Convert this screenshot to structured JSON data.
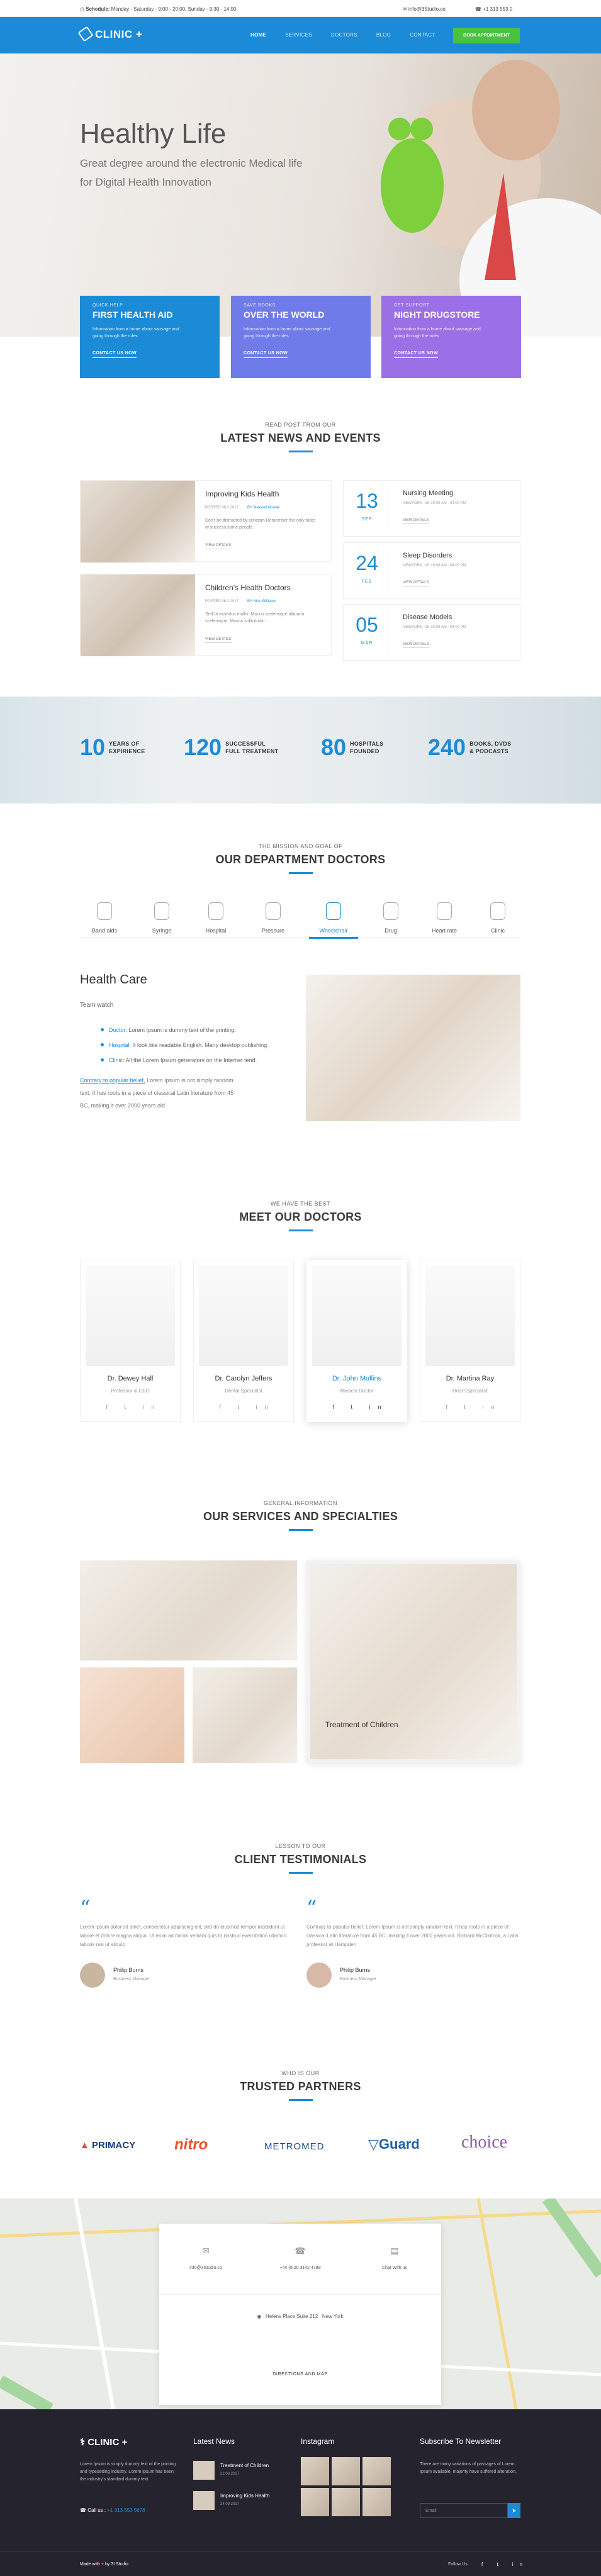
{
  "topbar": {
    "schedule_label": "Schedule:",
    "schedule": "Monday - Saturday - 9:00 - 20:00, Sunday - 9:30 - 14:00",
    "email": "info@3Studio.co",
    "phone": "+1 313 553 0"
  },
  "nav": {
    "logo": "CLINIC +",
    "items": [
      "HOME",
      "SERVICES",
      "DOCTORS",
      "BLOG",
      "CONTACT"
    ],
    "cta": "BOOK APPOINTMENT"
  },
  "hero": {
    "title": "Healthy Life",
    "subtitle": "Great degree around the electronic Medical life for Digital Health Innovation"
  },
  "cards": [
    {
      "small": "QUICK HELP",
      "title": "FIRST HEALTH AID",
      "text": "Information from a home about sausage and going through the rules",
      "link": "CONTACT US NOW",
      "color": "#1b8bd8"
    },
    {
      "small": "SAVE BOOKS",
      "title": "OVER THE WORLD",
      "text": "Information from a home about sausage and going through the rules",
      "link": "CONTACT US NOW",
      "color": "#6f7be8"
    },
    {
      "small": "GET SUPPORT",
      "title": "NIGHT DRUGSTORE",
      "text": "Information from a home about sausage and going through the rules",
      "link": "CONTACT US NOW",
      "color": "#9b6fe6"
    }
  ],
  "news_section": {
    "sub": "READ POST FROM OUR",
    "title": "LATEST NEWS AND EVENTS"
  },
  "news": [
    {
      "title": "Improving Kids Health",
      "date": "POSTED 06.2.2017",
      "author": "BY Maxwell Nowak",
      "excerpt": "Don't be distracted by criticism.Remember the only taste of success some people.",
      "link": "VIEW DETAILS"
    },
    {
      "title": "Children's Health Doctors",
      "date": "POSTED 06.2.2017",
      "author": "BY Nick Williams",
      "excerpt": "Sed ut modulus mollis. Mauris scelerisque aliquam scelerisque. Mauris sollicitudin.",
      "link": "VIEW DETAILS"
    }
  ],
  "events": [
    {
      "day": "13",
      "month": "SEP",
      "title": "Nursing Meeting",
      "meta": "NEWYORK, US  10:00 AM - 04:00 PM",
      "link": "VIEW DETAILS"
    },
    {
      "day": "24",
      "month": "FEB",
      "title": "Sleep Disorders",
      "meta": "NEWYORK, US  10:00 AM - 04:00 PM",
      "link": "VIEW DETAILS"
    },
    {
      "day": "05",
      "month": "MAR",
      "title": "Disease Models",
      "meta": "NEWYORK, US  10:00 AM - 04:00 PM",
      "link": "VIEW DETAILS"
    }
  ],
  "stats": [
    {
      "num": "10",
      "label1": "YEARS OF",
      "label2": "EXPIRIENCE"
    },
    {
      "num": "120",
      "label1": "SUCCESSFUL",
      "label2": "FULL TREATMENT"
    },
    {
      "num": "80",
      "label1": "HOSPITALS",
      "label2": "FOUNDED"
    },
    {
      "num": "240",
      "label1": "BOOKS, DVDS",
      "label2": "& PODCASTS"
    }
  ],
  "dept_section": {
    "sub": "THE MISSION AND GOAL OF",
    "title": "OUR DEPARTMENT DOCTORS"
  },
  "departments": [
    "Band aids",
    "Syringe",
    "Hospital",
    "Pressure",
    "Wheelchair",
    "Drug",
    "Heart rate",
    "Clinic"
  ],
  "health": {
    "title": "Health Care",
    "sub": "Team watch",
    "list": [
      {
        "k": "Doctor:",
        "v": "Lorem Ipsum is dummy text of the printing."
      },
      {
        "k": "Hospital:",
        "v": "It look like readable English. Many desktop publishing."
      },
      {
        "k": "Clinic:",
        "v": "All the Lorem Ipsum generators on the Internet tend."
      }
    ],
    "para_link": "Contrary to popular belief,",
    "para": "Lorem Ipsum is not simply random text. It has roots in a piece of classical Latin literature from 45 BC, making it over 2000 years old"
  },
  "doctors_section": {
    "sub": "WE HAVE THE BEST",
    "title": "MEET OUR DOCTORS"
  },
  "doctors": [
    {
      "name": "Dr. Dewey Hall",
      "role": "Professor & CEO"
    },
    {
      "name": "Dr. Carolyn Jeffers",
      "role": "Dental Specialist"
    },
    {
      "name": "Dr. John Mullins",
      "role": "Medical Doctor"
    },
    {
      "name": "Dr. Martina Ray",
      "role": "Heart Specialist"
    }
  ],
  "social": "f t in",
  "services_section": {
    "sub": "GENERAL INFORMATION",
    "title": "OUR SERVICES AND SPECIALTIES",
    "caption": "Treatment of Children"
  },
  "testi_section": {
    "sub": "LESSON TO OUR",
    "title": "CLIENT TESTIMONIALS"
  },
  "testimonials": [
    {
      "text": "Lorem ipsum dolor sit amet, consectetur adipiscing elit, sed do eiusmod tempor incididunt ut labore et dolore magna aliqua. Ut enim ad minim veniam quis to nostrud exercitation ullamco. laboris nisi ut aliquip.",
      "name": "Philip Burns",
      "role": "Business Manager"
    },
    {
      "text": "Contrary to popular belief, Lorem Ipsum is not simply random text. It has roots in a piece of classical Latin literature from 45 BC, making it over 2000 years old. Richard McClintock, a Latin professor at Hampden.",
      "name": "Philip Burns",
      "role": "Business Manager"
    }
  ],
  "partners_section": {
    "sub": "WHO IS OUR",
    "title": "TRUSTED PARTNERS"
  },
  "partners": [
    "PRIMACY",
    "nitro",
    "METROMED",
    "Guard",
    "choice"
  ],
  "contact": {
    "email": "info@3Studio.co",
    "phone": "+44 (0)20 3142 4789",
    "hours": "Chat With us",
    "address": "Helens Place Suite 212 , New York",
    "directions": "DIRECTIONS AND MAP"
  },
  "footer": {
    "logo": "CLINIC +",
    "about": "Lorem Ipsum is simply dummy text of the printing and typesetting industry. Lorem Ipsum has been the industry's standard dummy text.",
    "call_label": "Call us :",
    "call": "+1 313 553 5678",
    "news_title": "Latest News",
    "news": [
      {
        "t": "Treatment of Children",
        "d": "22.08.2017"
      },
      {
        "t": "Improving Kids Health",
        "d": "24.09.2017"
      }
    ],
    "insta_title": "Instagram",
    "nl_title": "Subscribe To Newsletter",
    "nl_text": "There are many variations of passages of Lorem Ipsum available, majority have suffered alteration.",
    "email_ph": "Email",
    "made": "Made with",
    "by": "by 3I Studio",
    "follow": "Follow Us",
    "social": "f t in"
  }
}
